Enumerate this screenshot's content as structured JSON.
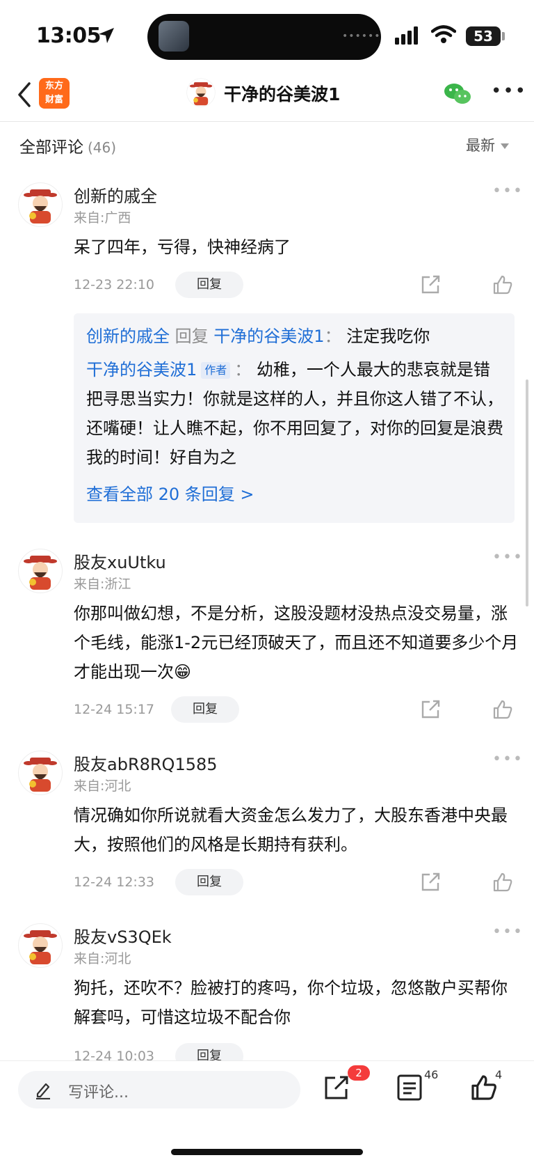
{
  "status_bar": {
    "time": "13:05",
    "battery": "53"
  },
  "header": {
    "app_logo_line1": "东方",
    "app_logo_line2": "财富",
    "title": "干净的谷美波1"
  },
  "comments_header": {
    "title": "全部评论",
    "count": "(46)",
    "sort": "最新"
  },
  "comments": [
    {
      "username": "创新的戚全",
      "region": "来自:广西",
      "content": "呆了四年，亏得，快神经病了",
      "timestamp": "12-23 22:10",
      "reply_label": "回复",
      "replies": {
        "line1": {
          "from": "创新的戚全",
          "verb": "回复",
          "to": "干净的谷美波1",
          "sep": "：",
          "text": "注定我吃你"
        },
        "line2": {
          "from": "干净的谷美波1",
          "tag": "作者",
          "sep": "：",
          "text": "幼稚，一个人最大的悲哀就是错把寻思当实力！你就是这样的人，并且你这人错了不认，还嘴硬！让人瞧不起，你不用回复了，对你的回复是浪费我的时间！好自为之"
        },
        "view_all": "查看全部 20 条回复 >"
      }
    },
    {
      "username": "股友xuUtku",
      "region": "来自:浙江",
      "content": "你那叫做幻想，不是分析，这股没题材没热点没交易量，涨个毛线，能涨1-2元已经顶破天了，而且还不知道要多少个月才能出现一次😁",
      "timestamp": "12-24 15:17",
      "reply_label": "回复"
    },
    {
      "username": "股友abR8RQ1585",
      "region": "来自:河北",
      "content": "情况确如你所说就看大资金怎么发力了，大股东香港中央最大，按照他们的风格是长期持有获利。",
      "timestamp": "12-24 12:33",
      "reply_label": "回复"
    },
    {
      "username": "股友vS3QEk",
      "region": "来自:河北",
      "content": "狗托，还吹不？脸被打的疼吗，你个垃圾，忽悠散户买帮你解套吗，可惜这垃圾不配合你",
      "timestamp": "12-24 10:03",
      "reply_label": "回复"
    }
  ],
  "bottom_bar": {
    "placeholder": "写评论...",
    "share_badge": "2",
    "comment_count": "46",
    "like_count": "4"
  },
  "icons": [
    "back-icon",
    "wechat-icon",
    "more-icon",
    "share-icon",
    "like-icon",
    "pen-icon",
    "comment-list-icon"
  ]
}
